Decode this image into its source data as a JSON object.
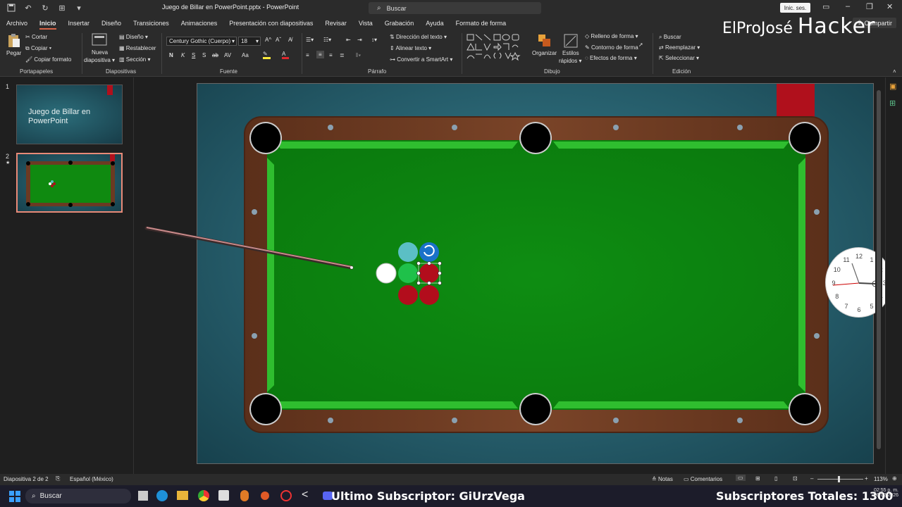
{
  "window": {
    "title": "Juego de Billar en PowerPoint.pptx - PowerPoint",
    "search_placeholder": "Buscar",
    "signin": "Inic. ses."
  },
  "menu": {
    "tabs": [
      "Archivo",
      "Inicio",
      "Insertar",
      "Diseño",
      "Transiciones",
      "Animaciones",
      "Presentación con diapositivas",
      "Revisar",
      "Vista",
      "Grabación",
      "Ayuda",
      "Formato de forma"
    ],
    "share": "Compartir"
  },
  "ribbon": {
    "clipboard": {
      "paste": "Pegar",
      "cut": "Cortar",
      "copy": "Copiar",
      "format_painter": "Copiar formato",
      "label": "Portapapeles"
    },
    "slides": {
      "new_slide": "Nueva",
      "new_slide2": "diapositiva",
      "layout": "Diseño",
      "reset": "Restablecer",
      "section": "Sección",
      "label": "Diapositivas"
    },
    "font": {
      "family": "Century Gothic (Cuerpo)",
      "size": "18",
      "label": "Fuente",
      "bold": "N",
      "italic": "K",
      "underline": "S",
      "strike": "S",
      "shadow": "ab",
      "spacing": "AV",
      "case": "Aa"
    },
    "paragraph": {
      "text_direction": "Dirección del texto",
      "align_text": "Alinear texto",
      "smartart": "Convertir a SmartArt",
      "label": "Párrafo"
    },
    "drawing": {
      "arrange": "Organizar",
      "quick_styles": "Estilos",
      "quick_styles2": "rápidos",
      "fill": "Relleno de forma",
      "outline": "Contorno de forma",
      "effects": "Efectos de forma",
      "label": "Dibujo"
    },
    "editing": {
      "find": "Buscar",
      "replace": "Reemplazar",
      "select": "Seleccionar",
      "label": "Edición"
    }
  },
  "brand": {
    "text": "ElProJosé",
    "big": "Hacker"
  },
  "slides_panel": {
    "slides": [
      {
        "number": "1",
        "title": "Juego de Billar en PowerPoint"
      },
      {
        "number": "2",
        "star": "★"
      }
    ]
  },
  "statusbar": {
    "slide_info": "Diapositiva 2 de 2",
    "language": "Español (México)",
    "notes": "Notas",
    "comments": "Comentarios",
    "zoom": "113%"
  },
  "taskbar": {
    "search": "Buscar",
    "last_sub": "Ultimo Subscriptor: GiUrzVega",
    "subs_total": "Subscriptores Totales: 1300",
    "time": "02:55 p. m.",
    "date": "06/02/2026"
  },
  "clock_numbers": [
    "12",
    "1",
    "2",
    "3",
    "4",
    "5",
    "6",
    "7",
    "8",
    "9",
    "10",
    "11"
  ],
  "colors": {
    "accent": "#d9664a",
    "felt": "#0f8a10",
    "rail": "#6b3a22",
    "ball_red": "#b20d1c",
    "ball_teal": "#5bbfc5",
    "ball_blue": "#1a72c9",
    "ball_green": "#1fc14a"
  }
}
